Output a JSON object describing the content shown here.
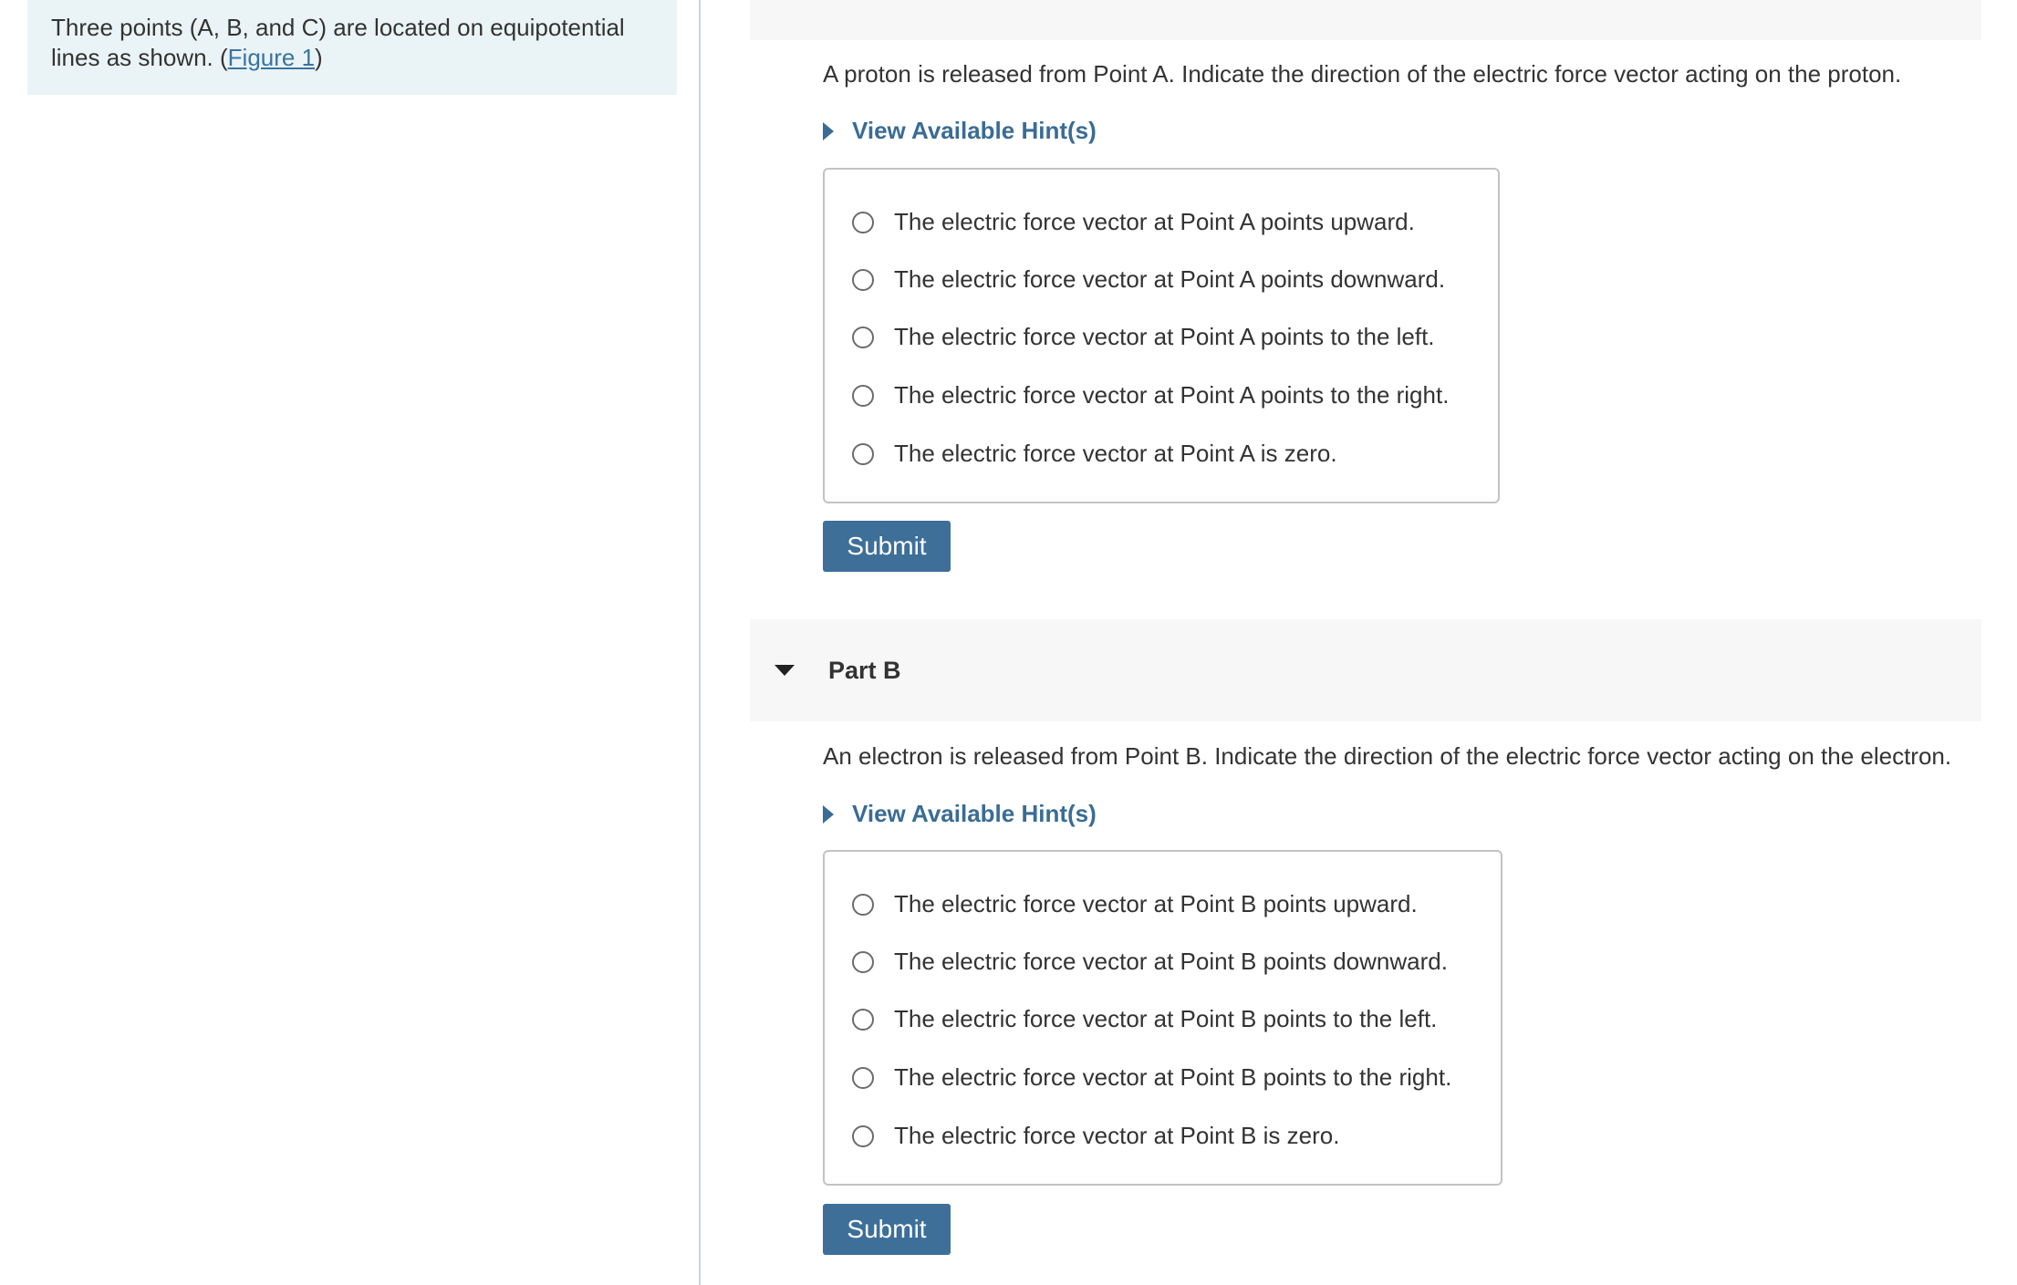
{
  "intro": {
    "text": "Three points (A, B, and C) are located on equipotential lines as shown. (",
    "figure_link": "Figure 1",
    "text_end": ")"
  },
  "part_a": {
    "question": "A proton is released from Point A. Indicate the direction of the electric force vector acting on the proton.",
    "hint_label": "View Available Hint(s)",
    "options": [
      "The electric force vector at Point A points upward.",
      "The electric force vector at Point A points downward.",
      "The electric force vector at Point A points to the left.",
      "The electric force vector at Point A points to the right.",
      "The electric force vector at Point A is zero."
    ],
    "submit_label": "Submit"
  },
  "part_b": {
    "title": "Part B",
    "question": "An electron is released from Point B. Indicate the direction of the electric force vector acting on the electron.",
    "hint_label": "View Available Hint(s)",
    "options": [
      "The electric force vector at Point B points upward.",
      "The electric force vector at Point B points downward.",
      "The electric force vector at Point B points to the left.",
      "The electric force vector at Point B points to the right.",
      "The electric force vector at Point B is zero."
    ],
    "submit_label": "Submit"
  },
  "icons": {
    "hint_expand": "caret-right-icon",
    "part_collapse": "caret-down-icon",
    "radio": "radio-unchecked-icon"
  },
  "colors": {
    "link": "#3b73a1",
    "button": "#3d6f99",
    "intro_bg": "#eaf4f6",
    "header_bg": "#f7f7f7"
  }
}
